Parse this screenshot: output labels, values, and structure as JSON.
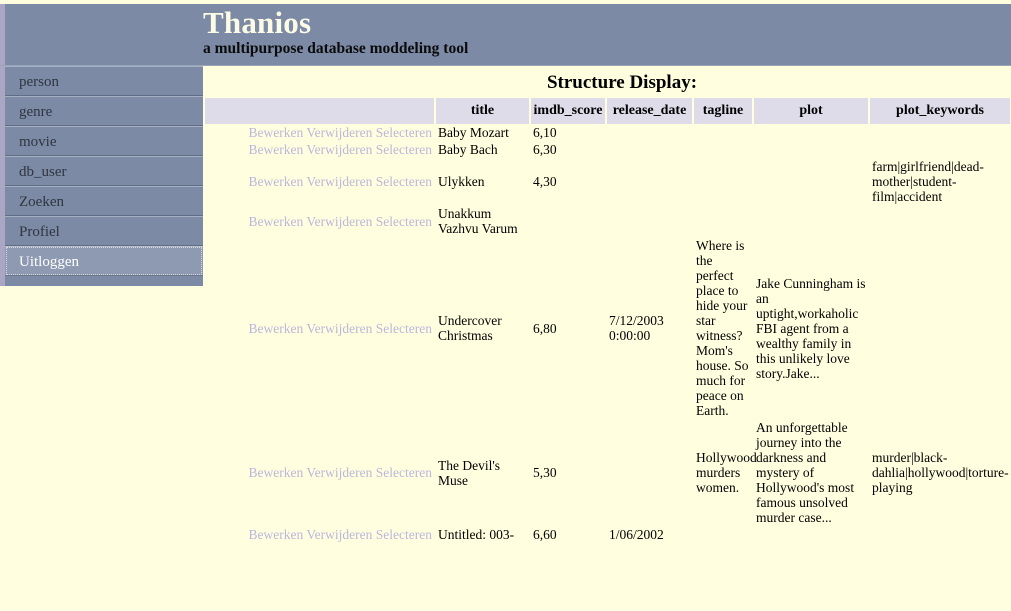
{
  "header": {
    "title": "Thanios",
    "subtitle": "a multipurpose database moddeling tool"
  },
  "sidebar": {
    "items": [
      {
        "label": "person",
        "selected": false
      },
      {
        "label": "genre",
        "selected": false
      },
      {
        "label": "movie",
        "selected": false
      },
      {
        "label": "db_user",
        "selected": false
      },
      {
        "label": "Zoeken",
        "selected": false
      },
      {
        "label": "Profiel",
        "selected": false
      },
      {
        "label": "Uitloggen",
        "selected": true
      }
    ]
  },
  "main": {
    "page_title": "Structure Display:",
    "actions": {
      "edit": "Bewerken",
      "delete": "Verwijderen",
      "select": "Selecteren"
    },
    "columns": [
      {
        "key": "actions",
        "label": ""
      },
      {
        "key": "title",
        "label": "title"
      },
      {
        "key": "imdb_score",
        "label": "imdb_score"
      },
      {
        "key": "release_date",
        "label": "release_date"
      },
      {
        "key": "tagline",
        "label": "tagline"
      },
      {
        "key": "plot",
        "label": "plot"
      },
      {
        "key": "plot_keywords",
        "label": "plot_keywords"
      }
    ],
    "rows": [
      {
        "title": "Baby Mozart",
        "imdb_score": "6,10",
        "release_date": "",
        "tagline": "",
        "plot": "",
        "plot_keywords": ""
      },
      {
        "title": "Baby Bach",
        "imdb_score": "6,30",
        "release_date": "",
        "tagline": "",
        "plot": "",
        "plot_keywords": ""
      },
      {
        "title": "Ulykken",
        "imdb_score": "4,30",
        "release_date": "",
        "tagline": "",
        "plot": "",
        "plot_keywords": "farm|girlfriend|dead-mother|student-film|accident"
      },
      {
        "title": "Unakkum Vazhvu Varum",
        "imdb_score": "",
        "release_date": "",
        "tagline": "",
        "plot": "",
        "plot_keywords": ""
      },
      {
        "title": "Undercover Christmas",
        "imdb_score": "6,80",
        "release_date": "7/12/2003 0:00:00",
        "tagline": "Where is the perfect place to hide your star witness? Mom's house. So much for peace on Earth.",
        "plot": "Jake Cunningham is an uptight,workaholic FBI agent from a wealthy family in this unlikely love story.Jake...",
        "plot_keywords": ""
      },
      {
        "title": "The Devil's Muse",
        "imdb_score": "5,30",
        "release_date": "",
        "tagline": "Hollywood murders women.",
        "plot": "An unforgettable journey into the darkness and mystery of Hollywood's most famous unsolved murder case...",
        "plot_keywords": "murder|black-dahlia|hollywood|torture-playing"
      },
      {
        "title": "Untitled: 003-",
        "imdb_score": "6,60",
        "release_date": "1/06/2002",
        "tagline": "",
        "plot": "",
        "plot_keywords": ""
      }
    ]
  },
  "colors": {
    "banner_bg": "#7c8aa5",
    "banner_edge": "#a9a7c4",
    "page_bg": "#ffffe0",
    "header_cell_bg": "#dfdcea",
    "link": "#bbb6dc",
    "selected_nav_bg": "#8e9ab2"
  }
}
